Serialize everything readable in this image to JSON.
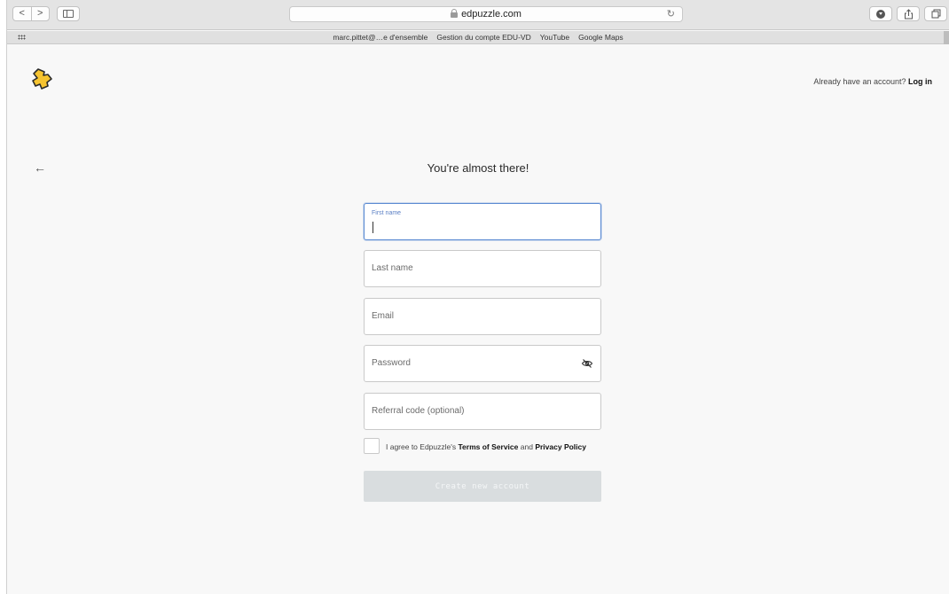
{
  "browser": {
    "nav_back": "<",
    "nav_forward": ">",
    "address": "edpuzzle.com",
    "reload": "↻",
    "bookmarks": [
      "marc.pittet@…e d'ensemble",
      "Gestion du compte EDU-VD",
      "YouTube",
      "Google Maps"
    ],
    "icons": [
      "back-icon",
      "forward-icon",
      "sidebar-icon",
      "lock-icon",
      "reload-icon",
      "download-icon",
      "share-icon",
      "tabs-icon",
      "grid-icon"
    ]
  },
  "header": {
    "login_prompt": "Already have an account?",
    "login_link": "Log in",
    "logo_color": "#f6c431"
  },
  "main": {
    "back": "←",
    "title": "You're almost there!",
    "fields": {
      "first_name_label": "First name",
      "last_name_placeholder": "Last name",
      "email_placeholder": "Email",
      "password_placeholder": "Password",
      "referral_placeholder": "Referral code (optional)"
    },
    "agree": {
      "prefix": "I agree to Edpuzzle's",
      "terms": "Terms of Service",
      "and": "and",
      "privacy": "Privacy Policy",
      "checked": false
    },
    "create_button": "Create new account",
    "focus_color": "#5a8ad2",
    "button_color": "#d9dddf"
  }
}
